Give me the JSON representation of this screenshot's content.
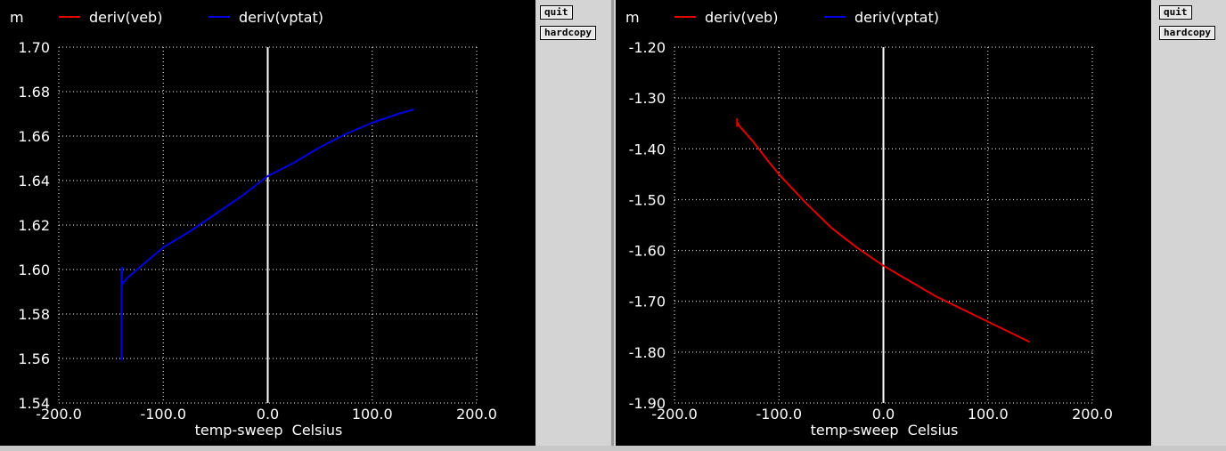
{
  "windows": [
    {
      "buttons": {
        "quit": "quit",
        "hardcopy": "hardcopy"
      },
      "chart_data": {
        "type": "line",
        "unit_prefix": "m",
        "xlabel": "temp-sweep  Celsius",
        "xlim": [
          -200,
          200
        ],
        "ylim": [
          1.54,
          1.7
        ],
        "x_ticks": [
          -200,
          -100,
          0,
          100,
          200
        ],
        "x_tick_labels": [
          "-200.0",
          "-100.0",
          "0.0",
          "100.0",
          "200.0"
        ],
        "y_ticks": [
          1.54,
          1.56,
          1.58,
          1.6,
          1.62,
          1.64,
          1.66,
          1.68,
          1.7
        ],
        "y_tick_labels": [
          "1.54",
          "1.56",
          "1.58",
          "1.60",
          "1.62",
          "1.64",
          "1.66",
          "1.68",
          "1.70"
        ],
        "grid": true,
        "legend_placement": "top",
        "legend": [
          {
            "name": "deriv(veb)",
            "color": "#e00000"
          },
          {
            "name": "deriv(vptat)",
            "color": "#0000e0"
          }
        ],
        "series": [
          {
            "name": "deriv(vptat)",
            "color": "#0000e0",
            "x": [
              -140,
              -140,
              -140,
              -139,
              -140,
              -135,
              -120,
              -100,
              -75,
              -50,
              -25,
              0,
              25,
              50,
              75,
              100,
              125,
              140
            ],
            "y": [
              1.559,
              1.575,
              1.6,
              1.601,
              1.593,
              1.596,
              1.602,
              1.61,
              1.617,
              1.625,
              1.633,
              1.642,
              1.648,
              1.655,
              1.661,
              1.666,
              1.67,
              1.672
            ]
          }
        ]
      }
    },
    {
      "buttons": {
        "quit": "quit",
        "hardcopy": "hardcopy"
      },
      "chart_data": {
        "type": "line",
        "unit_prefix": "m",
        "xlabel": "temp-sweep  Celsius",
        "xlim": [
          -200,
          200
        ],
        "ylim": [
          -1.9,
          -1.2
        ],
        "x_ticks": [
          -200,
          -100,
          0,
          100,
          200
        ],
        "x_tick_labels": [
          "-200.0",
          "-100.0",
          "0.0",
          "100.0",
          "200.0"
        ],
        "y_ticks": [
          -1.9,
          -1.8,
          -1.7,
          -1.6,
          -1.5,
          -1.4,
          -1.3,
          -1.2
        ],
        "y_tick_labels": [
          "-1.90",
          "-1.80",
          "-1.70",
          "-1.60",
          "-1.50",
          "-1.40",
          "-1.30",
          "-1.20"
        ],
        "grid": true,
        "legend_placement": "top",
        "legend": [
          {
            "name": "deriv(veb)",
            "color": "#e00000"
          },
          {
            "name": "deriv(vptat)",
            "color": "#0000e0"
          }
        ],
        "series": [
          {
            "name": "deriv(veb)",
            "color": "#e00000",
            "x": [
              -140,
              -140,
              -139,
              -138,
              -125,
              -110,
              -100,
              -75,
              -50,
              -25,
              0,
              25,
              50,
              75,
              100,
              125,
              140
            ],
            "y": [
              -1.34,
              -1.355,
              -1.35,
              -1.355,
              -1.385,
              -1.425,
              -1.45,
              -1.505,
              -1.555,
              -1.595,
              -1.63,
              -1.66,
              -1.69,
              -1.715,
              -1.74,
              -1.765,
              -1.78
            ]
          }
        ]
      }
    }
  ]
}
